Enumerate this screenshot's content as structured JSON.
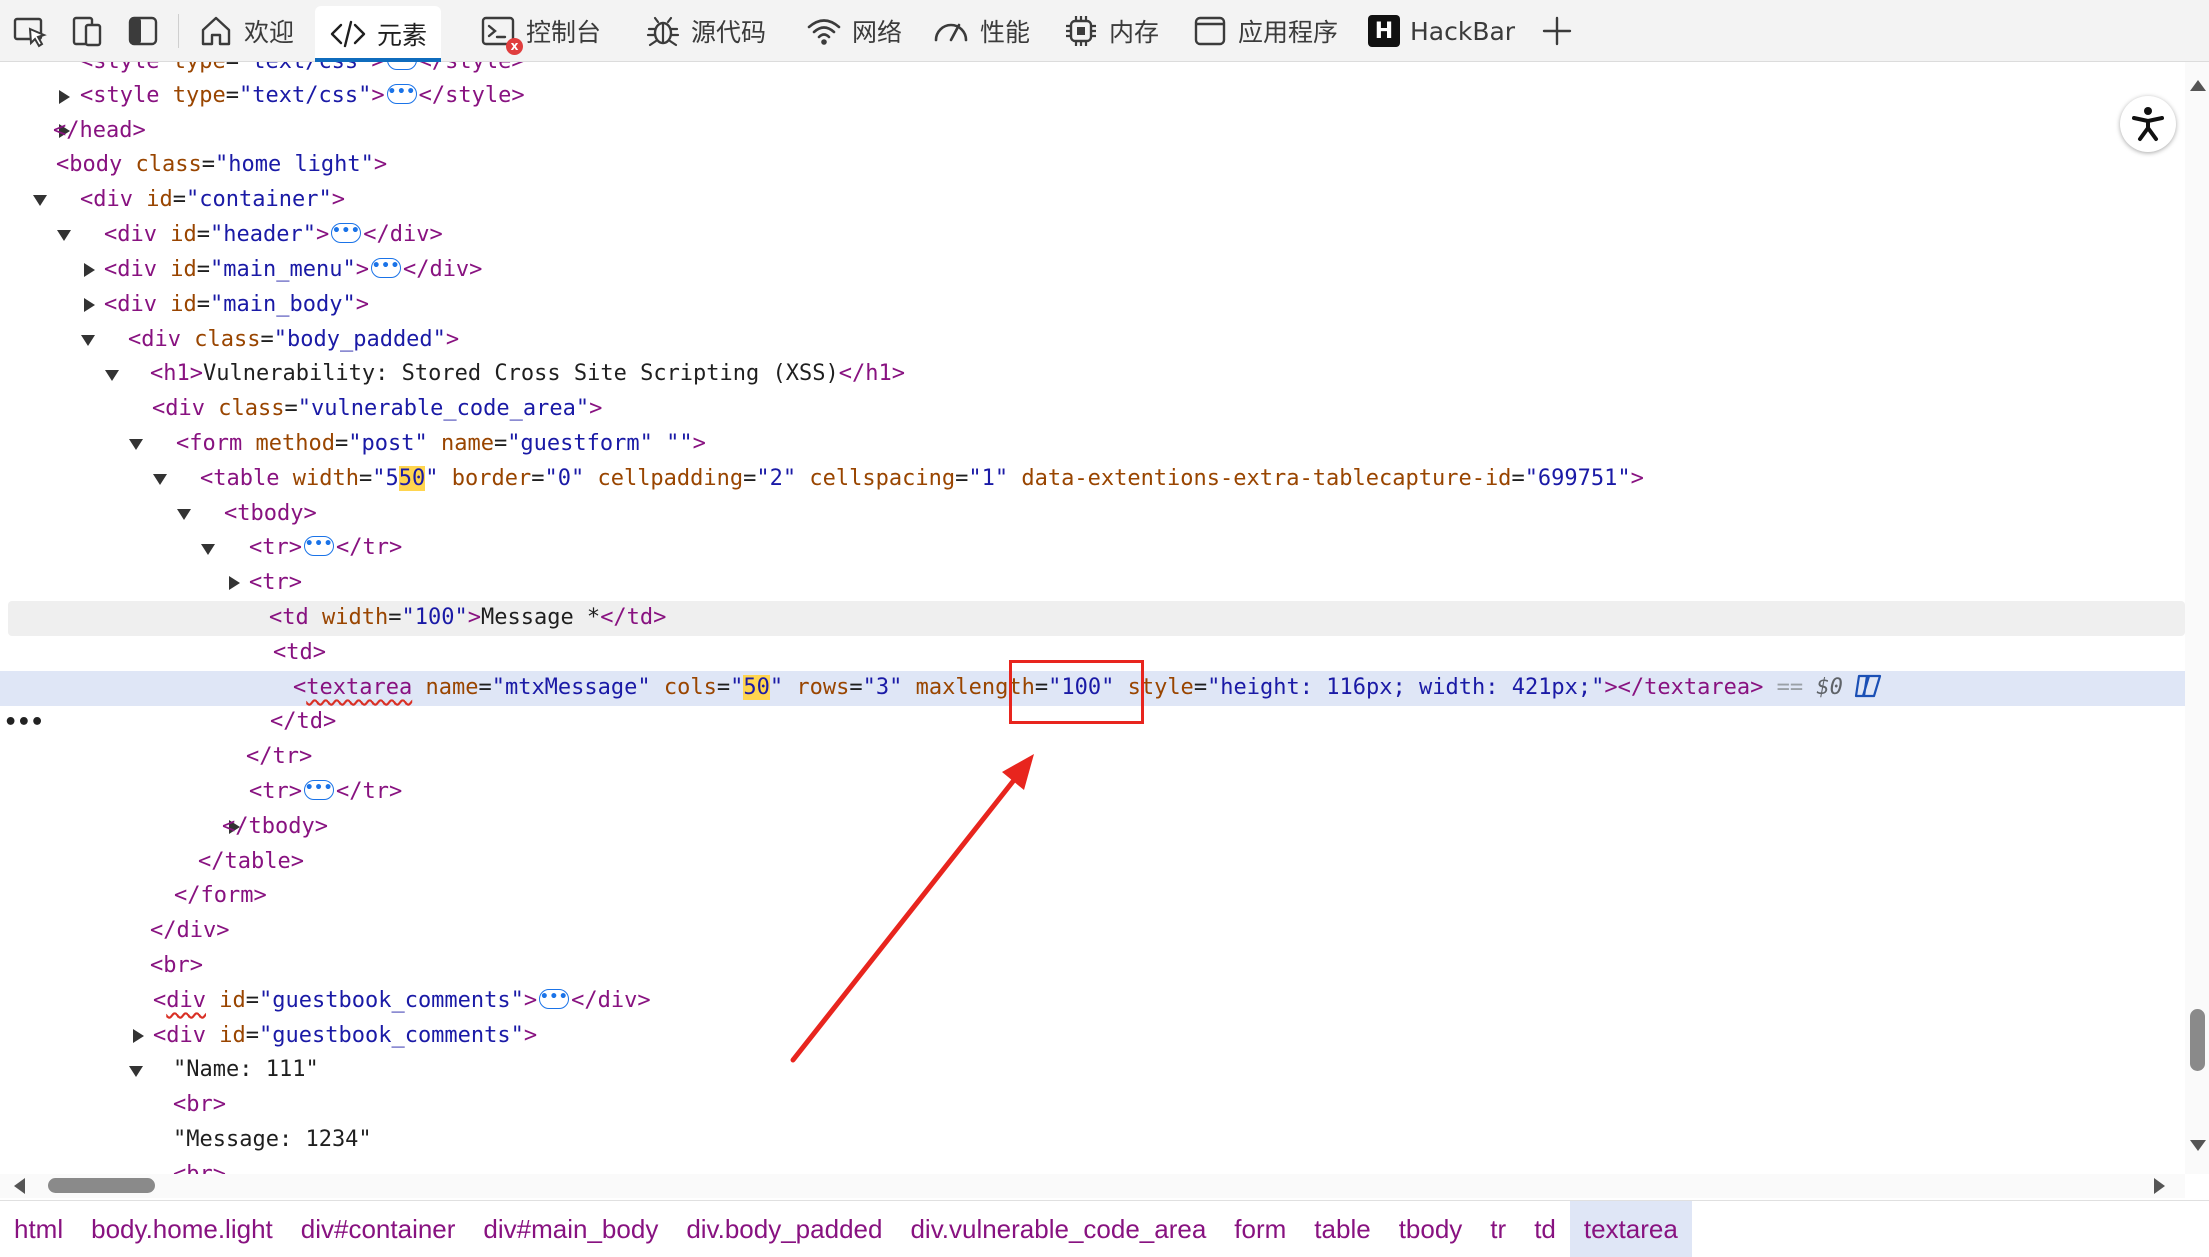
{
  "toolbar": {
    "tabs": [
      {
        "label": "欢迎",
        "icon": "home-icon"
      },
      {
        "label": "元素",
        "icon": "code-brackets-icon"
      },
      {
        "label": "控制台",
        "icon": "console-icon"
      },
      {
        "label": "源代码",
        "icon": "bug-icon"
      },
      {
        "label": "网络",
        "icon": "wifi-icon"
      },
      {
        "label": "性能",
        "icon": "gauge-icon"
      },
      {
        "label": "内存",
        "icon": "chip-icon"
      },
      {
        "label": "应用程序",
        "icon": "app-window-icon"
      },
      {
        "label": "HackBar",
        "icon": "hackbar-logo-icon",
        "logo_letter": "H"
      }
    ],
    "console_error_badge": "x"
  },
  "tree": {
    "r0": {
      "tag": "style",
      "a1": "type",
      "v1": "\"text/css\""
    },
    "r1": {
      "lt": "<",
      "tag": "style",
      "a1": "type",
      "v1": "\"text/css\"",
      "end": "</style>"
    },
    "r2": {
      "text": "</head>"
    },
    "r3": {
      "lt": "<",
      "tag": "body",
      "a1": "class",
      "v1": "\"home light\""
    },
    "r4": {
      "lt": "<",
      "tag": "div",
      "a1": "id",
      "v1": "\"container\""
    },
    "r5": {
      "lt": "<",
      "tag": "div",
      "a1": "id",
      "v1": "\"header\"",
      "end": "</div>"
    },
    "r6": {
      "lt": "<",
      "tag": "div",
      "a1": "id",
      "v1": "\"main_menu\"",
      "end": "</div>"
    },
    "r7": {
      "lt": "<",
      "tag": "div",
      "a1": "id",
      "v1": "\"main_body\""
    },
    "r8": {
      "lt": "<",
      "tag": "div",
      "a1": "class",
      "v1": "\"body_padded\""
    },
    "r9": {
      "open": "<h1>",
      "text": "Vulnerability: Stored Cross Site Scripting (XSS)",
      "close": "</h1>"
    },
    "r10": {
      "lt": "<",
      "tag": "div",
      "a1": "class",
      "v1": "\"vulnerable_code_area\""
    },
    "r11": {
      "lt": "<",
      "tag": "form",
      "a1": "method",
      "v1": "\"post\"",
      "a2": "name",
      "v2": "\"guestform\"",
      "v3": "\"\""
    },
    "r12": {
      "lt": "<",
      "tag": "table",
      "a1": "width",
      "v1a": "\"5",
      "v1b": "50",
      "v1c": "\"",
      "a2": "border",
      "v2": "\"0\"",
      "a3": "cellpadding",
      "v3": "\"2\"",
      "a4": "cellspacing",
      "v4": "\"1\"",
      "a5": "data-extentions-extra-tablecapture-id",
      "v5": "\"699751\""
    },
    "r13": {
      "text": "<tbody>"
    },
    "r14": {
      "open": "<tr>",
      "close": "</tr>"
    },
    "r15": {
      "text": "<tr>"
    },
    "r16": {
      "lt": "<",
      "tag": "td",
      "a1": "width",
      "v1": "\"100\"",
      "content": "Message *",
      "close": "</td>"
    },
    "r17": {
      "text": "<td>"
    },
    "r18": {
      "lt": "<",
      "tag": "textarea",
      "a1": "name",
      "v1": "\"mtxMessage\"",
      "a2": "cols",
      "v2a": "\"",
      "v2b": "50",
      "v2c": "\"",
      "a3": "rows",
      "v3": "\"3\"",
      "a4": "maxlength",
      "v4": "\"100\"",
      "a5": "style",
      "v5": "\"height: 116px; width: 421px;\"",
      "close": "</textarea>",
      "eq": "==",
      "dollar": "$0"
    },
    "r19": {
      "text": "</td>"
    },
    "r20": {
      "text": "</tr>"
    },
    "r21": {
      "open": "<tr>",
      "close": "</tr>"
    },
    "r22": {
      "text": "</tbody>"
    },
    "r23": {
      "text": "</table>"
    },
    "r24": {
      "text": "</form>"
    },
    "r25": {
      "text": "</div>"
    },
    "r26": {
      "text": "<br>"
    },
    "r27": {
      "lt": "<",
      "tag": "div",
      "a1": "id",
      "v1": "\"guestbook_comments\"",
      "end": "</div>"
    },
    "r28": {
      "lt": "<",
      "tag": "div",
      "a1": "id",
      "v1": "\"guestbook_comments\""
    },
    "r29": {
      "text": "\"Name: 111\""
    },
    "r30": {
      "text": "<br>"
    },
    "r31": {
      "text": "\"Message: 1234\""
    },
    "r32": {
      "text": "<br>"
    },
    "selected_row_dots": "•••"
  },
  "breadcrumbs": [
    "html",
    "body.home.light",
    "div#container",
    "div#main_body",
    "div.body_padded",
    "div.vulnerable_code_area",
    "form",
    "table",
    "tbody",
    "tr",
    "td",
    "textarea"
  ],
  "colors": {
    "tag": "#881280",
    "attr_name": "#994500",
    "attr_value": "#1a1aa6",
    "selected_row": "#dfe6f6",
    "annotation": "#e8251e",
    "accent": "#0f6cbd"
  }
}
